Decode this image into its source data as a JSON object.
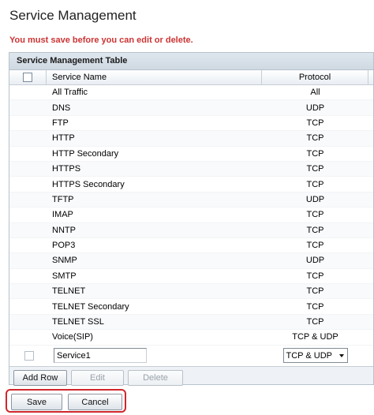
{
  "page": {
    "title": "Service Management",
    "warning": "You must save before you can edit or delete."
  },
  "table": {
    "title": "Service Management Table",
    "columns": {
      "name": "Service Name",
      "protocol": "Protocol"
    },
    "rows": [
      {
        "name": "All Traffic",
        "protocol": "All"
      },
      {
        "name": "DNS",
        "protocol": "UDP"
      },
      {
        "name": "FTP",
        "protocol": "TCP"
      },
      {
        "name": "HTTP",
        "protocol": "TCP"
      },
      {
        "name": "HTTP Secondary",
        "protocol": "TCP"
      },
      {
        "name": "HTTPS",
        "protocol": "TCP"
      },
      {
        "name": "HTTPS Secondary",
        "protocol": "TCP"
      },
      {
        "name": "TFTP",
        "protocol": "UDP"
      },
      {
        "name": "IMAP",
        "protocol": "TCP"
      },
      {
        "name": "NNTP",
        "protocol": "TCP"
      },
      {
        "name": "POP3",
        "protocol": "TCP"
      },
      {
        "name": "SNMP",
        "protocol": "UDP"
      },
      {
        "name": "SMTP",
        "protocol": "TCP"
      },
      {
        "name": "TELNET",
        "protocol": "TCP"
      },
      {
        "name": "TELNET Secondary",
        "protocol": "TCP"
      },
      {
        "name": "TELNET SSL",
        "protocol": "TCP"
      },
      {
        "name": "Voice(SIP)",
        "protocol": "TCP & UDP"
      }
    ],
    "new_row": {
      "name_value": "Service1",
      "protocol_selected": "TCP & UDP"
    }
  },
  "toolbar": {
    "add_row": "Add Row",
    "edit": "Edit",
    "delete": "Delete"
  },
  "footer": {
    "save": "Save",
    "cancel": "Cancel"
  },
  "colors": {
    "warning": "#cc3333",
    "highlight": "#d0262c"
  }
}
